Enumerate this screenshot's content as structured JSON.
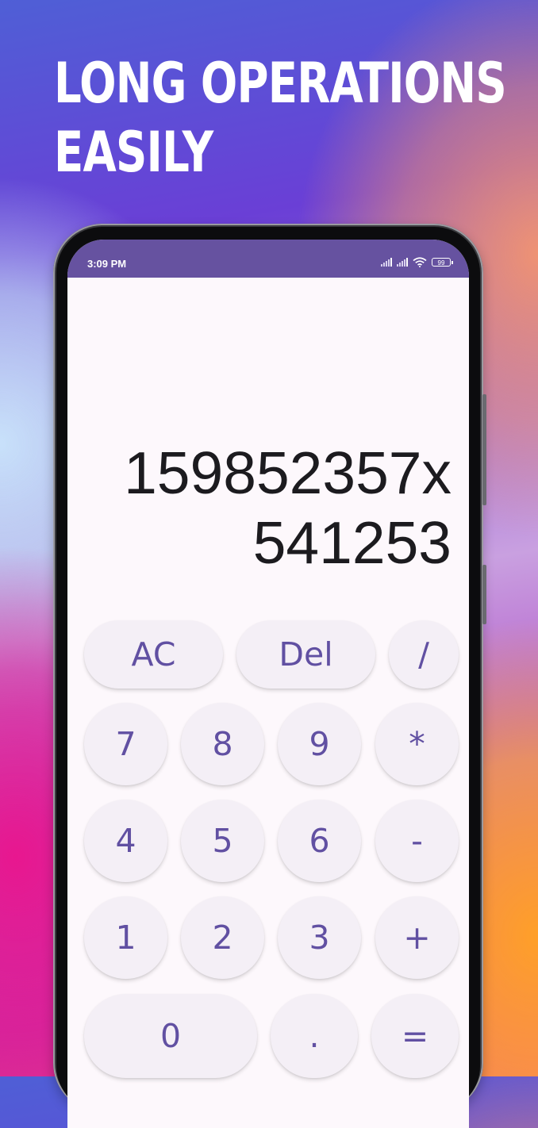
{
  "headline": {
    "line1": "Long operations",
    "line2": "easily"
  },
  "status_bar": {
    "time": "3:09 PM",
    "battery": "99"
  },
  "display": {
    "line1": "159852357x",
    "line2": "541253"
  },
  "keys": {
    "ac": "AC",
    "del": "Del",
    "divide": "/",
    "seven": "7",
    "eight": "8",
    "nine": "9",
    "multiply": "*",
    "four": "4",
    "five": "5",
    "six": "6",
    "minus": "-",
    "one": "1",
    "two": "2",
    "three": "3",
    "plus": "+",
    "zero": "0",
    "dot": ".",
    "equals": "="
  },
  "colors": {
    "status_bar": "#6652a0",
    "key_text": "#6150a2",
    "key_bg": "#f4eff6",
    "screen_bg": "#fdf8fc"
  }
}
